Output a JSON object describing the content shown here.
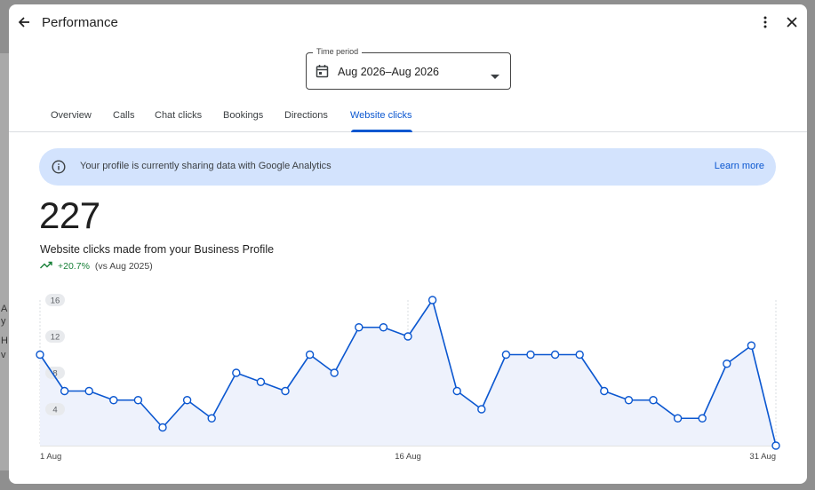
{
  "header": {
    "title": "Performance"
  },
  "time_period": {
    "legend": "Time period",
    "value": "Aug 2026–Aug 2026"
  },
  "tabs": [
    "Overview",
    "Calls",
    "Chat clicks",
    "Bookings",
    "Directions",
    "Website clicks"
  ],
  "active_tab": "Website clicks",
  "banner": {
    "text": "Your profile is currently sharing data with Google Analytics",
    "link": "Learn more"
  },
  "metric": {
    "value": "227",
    "label": "Website clicks made from your Business Profile",
    "change": "+20.7%",
    "comparison": "(vs Aug 2025)"
  },
  "colors": {
    "accent": "#0b57d0",
    "positive": "#188038",
    "banner_bg": "#d3e3fd"
  },
  "chart_data": {
    "type": "line",
    "x": [
      "1 Aug",
      "2 Aug",
      "3 Aug",
      "4 Aug",
      "5 Aug",
      "6 Aug",
      "7 Aug",
      "8 Aug",
      "9 Aug",
      "10 Aug",
      "11 Aug",
      "12 Aug",
      "13 Aug",
      "14 Aug",
      "15 Aug",
      "16 Aug",
      "17 Aug",
      "18 Aug",
      "19 Aug",
      "20 Aug",
      "21 Aug",
      "22 Aug",
      "23 Aug",
      "24 Aug",
      "25 Aug",
      "26 Aug",
      "27 Aug",
      "28 Aug",
      "29 Aug",
      "30 Aug",
      "31 Aug"
    ],
    "values": [
      10,
      6,
      6,
      5,
      5,
      2,
      5,
      3,
      8,
      7,
      6,
      10,
      8,
      13,
      13,
      12,
      16,
      6,
      4,
      10,
      10,
      10,
      10,
      6,
      5,
      5,
      3,
      3,
      9,
      11,
      0
    ],
    "ylim": [
      0,
      16
    ],
    "y_ticks": [
      "4",
      "8",
      "12",
      "16"
    ],
    "x_tick_labels": [
      "1 Aug",
      "16 Aug",
      "31 Aug"
    ],
    "grid": true
  }
}
